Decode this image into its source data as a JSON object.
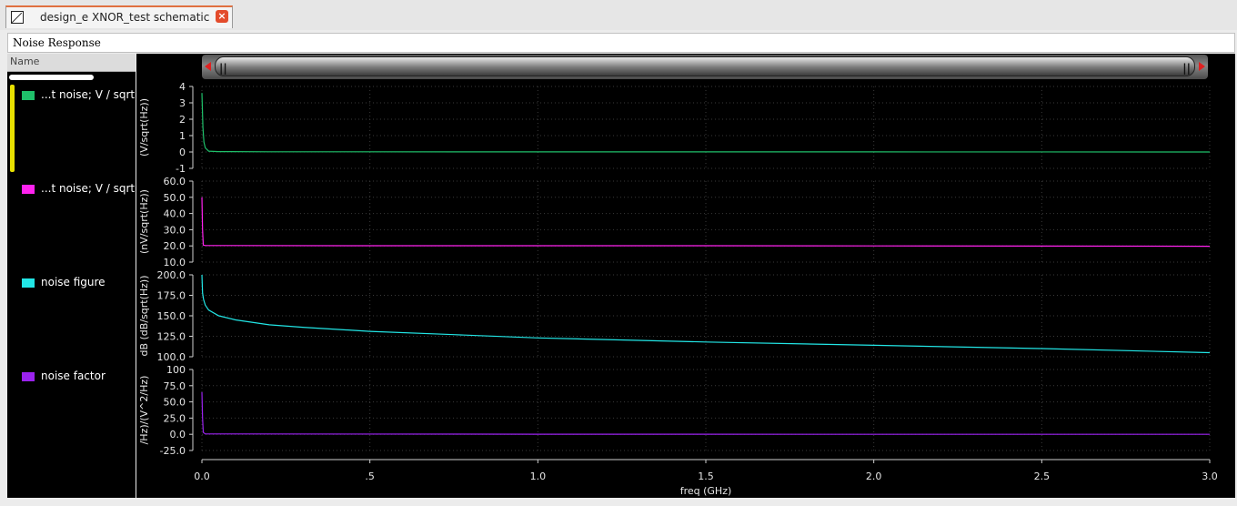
{
  "tab": {
    "title": "design_e XNOR_test schematic",
    "close": "×"
  },
  "panel": {
    "title": "Noise Response"
  },
  "sidebar": {
    "header": "Name"
  },
  "legend": [
    {
      "label": "...t noise; V / sqrt(H",
      "color": "#1fc06a"
    },
    {
      "label": "...t noise; V / sqrt(H",
      "color": "#ff22ee"
    },
    {
      "label": "noise figure",
      "color": "#22e6e6"
    },
    {
      "label": "noise factor",
      "color": "#9a22ee"
    }
  ],
  "scrollbar": {
    "grip_left": "||",
    "grip_right": "||"
  },
  "chart_data": {
    "type": "line",
    "xlabel": "freq (GHz)",
    "x_ticks": [
      0.0,
      0.5,
      1.0,
      1.5,
      2.0,
      2.5,
      3.0
    ],
    "x_tick_labels": [
      "0.0",
      ".5",
      "1.0",
      "1.5",
      "2.0",
      "2.5",
      "3.0"
    ],
    "xlim": [
      0,
      3.0
    ],
    "grid": true,
    "strips": [
      {
        "name": "...t noise; V / sqrt(Hz)",
        "ylabel": "(V/sqrt(Hz))",
        "color": "#1fc06a",
        "ylim": [
          -1,
          4
        ],
        "y_ticks": [
          4,
          3,
          2,
          1,
          0,
          -1
        ],
        "y_tick_labels": [
          "4",
          "3",
          "2",
          "1",
          "0",
          "-1"
        ],
        "x": [
          0.0,
          0.003,
          0.006,
          0.01,
          0.02,
          0.05,
          0.2,
          1.0,
          2.0,
          3.0
        ],
        "y": [
          3.6,
          1.5,
          0.6,
          0.25,
          0.05,
          0.02,
          0.01,
          0.005,
          0.003,
          0.002
        ]
      },
      {
        "name": "...t noise; V / sqrt(Hz)",
        "ylabel": "(nV/sqrt(Hz))",
        "color": "#ff22ee",
        "ylim": [
          10,
          60
        ],
        "y_ticks": [
          60,
          50,
          40,
          30,
          20,
          10
        ],
        "y_tick_labels": [
          "60.0",
          "50.0",
          "40.0",
          "30.0",
          "20.0",
          "10.0"
        ],
        "x": [
          0.0,
          0.002,
          0.004,
          0.01,
          0.5,
          1.0,
          1.5,
          2.0,
          2.5,
          3.0
        ],
        "y": [
          50.0,
          30.0,
          20.5,
          20.2,
          20.1,
          20.1,
          20.1,
          20.0,
          19.9,
          19.8
        ]
      },
      {
        "name": "noise figure",
        "ylabel": "dB (dB/sqrt(Hz))",
        "color": "#22e6e6",
        "ylim": [
          100,
          200
        ],
        "y_ticks": [
          200,
          175,
          150,
          125,
          100
        ],
        "y_tick_labels": [
          "200.0",
          "175.0",
          "150.0",
          "125.0",
          "100.0"
        ],
        "x": [
          0.0,
          0.002,
          0.005,
          0.01,
          0.02,
          0.05,
          0.1,
          0.2,
          0.3,
          0.5,
          0.75,
          1.0,
          1.5,
          2.0,
          2.5,
          3.0
        ],
        "y": [
          200.0,
          178.0,
          170.0,
          163.0,
          157.0,
          150.0,
          145.0,
          139.0,
          136.0,
          131.0,
          127.0,
          123.0,
          118.0,
          114.0,
          110.0,
          105.0
        ]
      },
      {
        "name": "noise factor",
        "ylabel": "/Hz)/(V^2/Hz)",
        "color": "#9a22ee",
        "ylim": [
          -25,
          100
        ],
        "y_ticks": [
          100,
          75,
          50,
          25,
          0,
          -25
        ],
        "y_tick_labels": [
          "100",
          "75.0",
          "50.0",
          "25.0",
          "0.0",
          "-25.0"
        ],
        "x": [
          0.0,
          0.002,
          0.004,
          0.01,
          1.0,
          2.0,
          3.0
        ],
        "y": [
          65.0,
          25.0,
          3.0,
          0.5,
          0.1,
          0.05,
          0.02
        ]
      }
    ]
  }
}
